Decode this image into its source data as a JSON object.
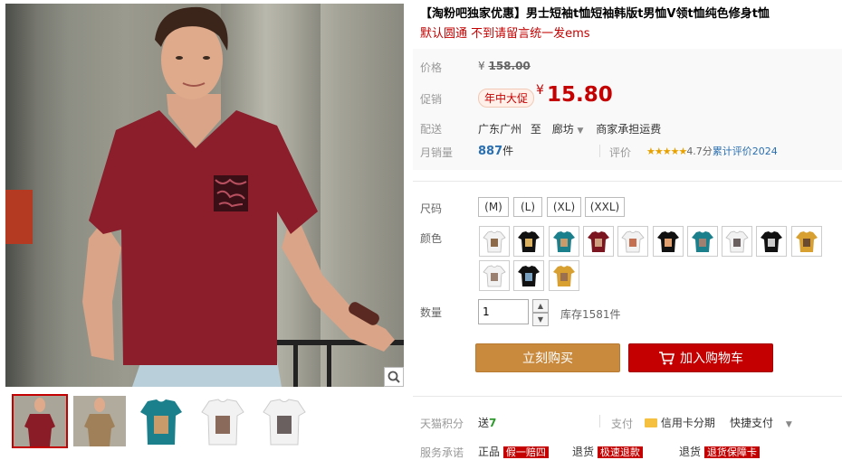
{
  "product": {
    "title": "【淘粉吧独家优惠】男士短袖t恤短袖韩版t男恤V领t恤纯色修身t恤",
    "subtitle": "默认圆通 不到请留言统一发ems"
  },
  "price": {
    "label": "价格",
    "currency": "¥",
    "original": "158.00",
    "promo_label": "促销",
    "promo_tag": "年中大促",
    "promo_currency": "¥",
    "promo_price": "15.80"
  },
  "shipping": {
    "label": "配送",
    "from": "广东广州",
    "to_word": "至",
    "to": "廊坊",
    "note": "商家承担运费"
  },
  "sales": {
    "label": "月销量",
    "count": "887",
    "unit": "件",
    "review_label": "评价",
    "stars": "★★★★★",
    "rating": "4.7分",
    "review_count_text": "累计评价2024"
  },
  "options": {
    "size_label": "尺码",
    "sizes": [
      "(M)",
      "(L)",
      "(XL)",
      "(XXL)"
    ],
    "color_label": "颜色",
    "swatch_colors": [
      "#f2f2f2",
      "#111111",
      "#1c7f8c",
      "#7b1620",
      "#f2f2f2",
      "#111111",
      "#1c7f8c",
      "#f2f2f2",
      "#111111",
      "#d7a030",
      "#f2f2f2",
      "#111111",
      "#d7a030"
    ],
    "swatch_prints": [
      "#8c6a4a",
      "#d8b060",
      "#c99a6a",
      "#cfa080",
      "#c47050",
      "#e0a070",
      "#a08070",
      "#6a6060",
      "#cccccc",
      "#6a4a30",
      "#9a8070",
      "#7aa0c0",
      "#9a7050"
    ]
  },
  "quantity": {
    "label": "数量",
    "value": "1",
    "stock": "库存1581件"
  },
  "buttons": {
    "buy_now": "立刻购买",
    "add_to_cart": "加入购物车"
  },
  "bottom": {
    "points_label": "天猫积分",
    "points_prefix": "送",
    "points_value": "7",
    "pay_label": "支付",
    "credit_installment": "信用卡分期",
    "quick_pay": "快捷支付",
    "service_label": "服务承诺",
    "service_item1": "正品",
    "service_tag1": "假一赔四",
    "service_item2": "退货",
    "service_tag2": "极速退款",
    "service_item3": "退货",
    "service_tag3": "退货保障卡"
  },
  "gallery": {
    "thumb_colors": [
      "#8a1c28",
      "#a08058",
      "#1c7f8c",
      "#f2f2f2",
      "#f2f2f2"
    ],
    "main_shirt_color": "#8c1d2b"
  }
}
